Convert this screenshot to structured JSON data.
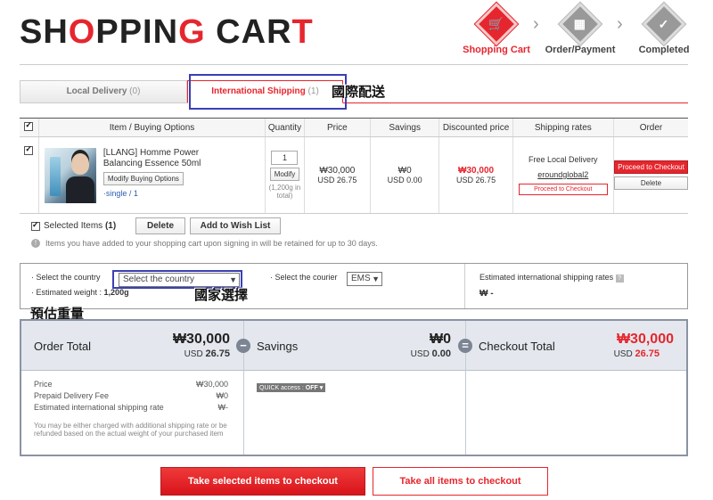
{
  "header": {
    "title_a": "SH",
    "title_b": "O",
    "title_c": "PPIN",
    "title_d": "G",
    "title_e": " CAR",
    "title_f": "T",
    "steps": [
      {
        "label": "Shopping Cart",
        "icon": "cart-icon"
      },
      {
        "label": "Order/Payment",
        "icon": "calculator-icon"
      },
      {
        "label": "Completed",
        "icon": "check-icon"
      }
    ]
  },
  "tabs": [
    {
      "label": "Local Delivery",
      "count": "(0)"
    },
    {
      "label": "International Shipping",
      "count": "(1)"
    }
  ],
  "annotations": {
    "intl_shipping": "國際配送",
    "select_country": "國家選擇",
    "est_weight": "預估重量"
  },
  "cart_table": {
    "headers": [
      "Item / Buying Options",
      "Quantity",
      "Price",
      "Savings",
      "Discounted price",
      "Shipping rates",
      "Order"
    ],
    "item": {
      "name": "[LLANG] Homme Power Balancing Essence 50ml",
      "modify_options": "Modify Buying Options",
      "option": "single / 1",
      "qty": "1",
      "modify": "Modify",
      "weight": "(1,200g in total)",
      "price_krw": "₩30,000",
      "price_usd": "USD 26.75",
      "savings_krw": "₩0",
      "savings_usd": "USD 0.00",
      "disc_krw": "₩30,000",
      "disc_usd": "USD 26.75",
      "ship_free": "Free Local Delivery",
      "ship_seller": "eroundglobal2",
      "ship_btn": "Proceed to Checkout",
      "order_checkout": "Proceed to Checkout",
      "order_delete": "Delete"
    }
  },
  "selection": {
    "selected_label": "Selected Items",
    "selected_count": "(1)",
    "delete": "Delete",
    "wishlist": "Add to Wish List",
    "notice": "Items you have added to your shopping cart upon signing in will be retained for up to 30 days."
  },
  "shipping": {
    "country_label": "· Select the country",
    "country_value": "Select the country",
    "courier_label": "· Select the courier",
    "courier_value": "EMS",
    "weight_label": "· Estimated weight :",
    "weight_value": "1,200g",
    "est_rates_label": "Estimated international shipping rates",
    "est_rates_help": "?",
    "est_rates_value": "₩ -"
  },
  "totals": {
    "order_total_label": "Order Total",
    "order_total_krw": "₩30,000",
    "order_total_usd_prefix": "USD",
    "order_total_usd": "26.75",
    "savings_label": "Savings",
    "savings_krw": "₩0",
    "savings_usd_prefix": "USD",
    "savings_usd": "0.00",
    "checkout_label": "Checkout Total",
    "checkout_krw": "₩30,000",
    "checkout_usd_prefix": "USD",
    "checkout_usd": "26.75",
    "minus": "−",
    "equals": "=",
    "breakdown": [
      {
        "label": "Price",
        "value": "₩30,000"
      },
      {
        "label": "Prepaid Delivery Fee",
        "value": "₩0"
      },
      {
        "label": "Estimated international shipping rate",
        "value": "₩-"
      }
    ],
    "note": "You may be either charged with additional shipping rate or be refunded based on the actual weight of your purchased item",
    "quick_access": "QUICK access :",
    "quick_state": "OFF ▾"
  },
  "buttons": {
    "take_selected": "Take selected items to checkout",
    "take_all": "Take all items to checkout"
  },
  "colors": {
    "accent": "#e6262e",
    "annotation_box": "#3b3fb4"
  }
}
